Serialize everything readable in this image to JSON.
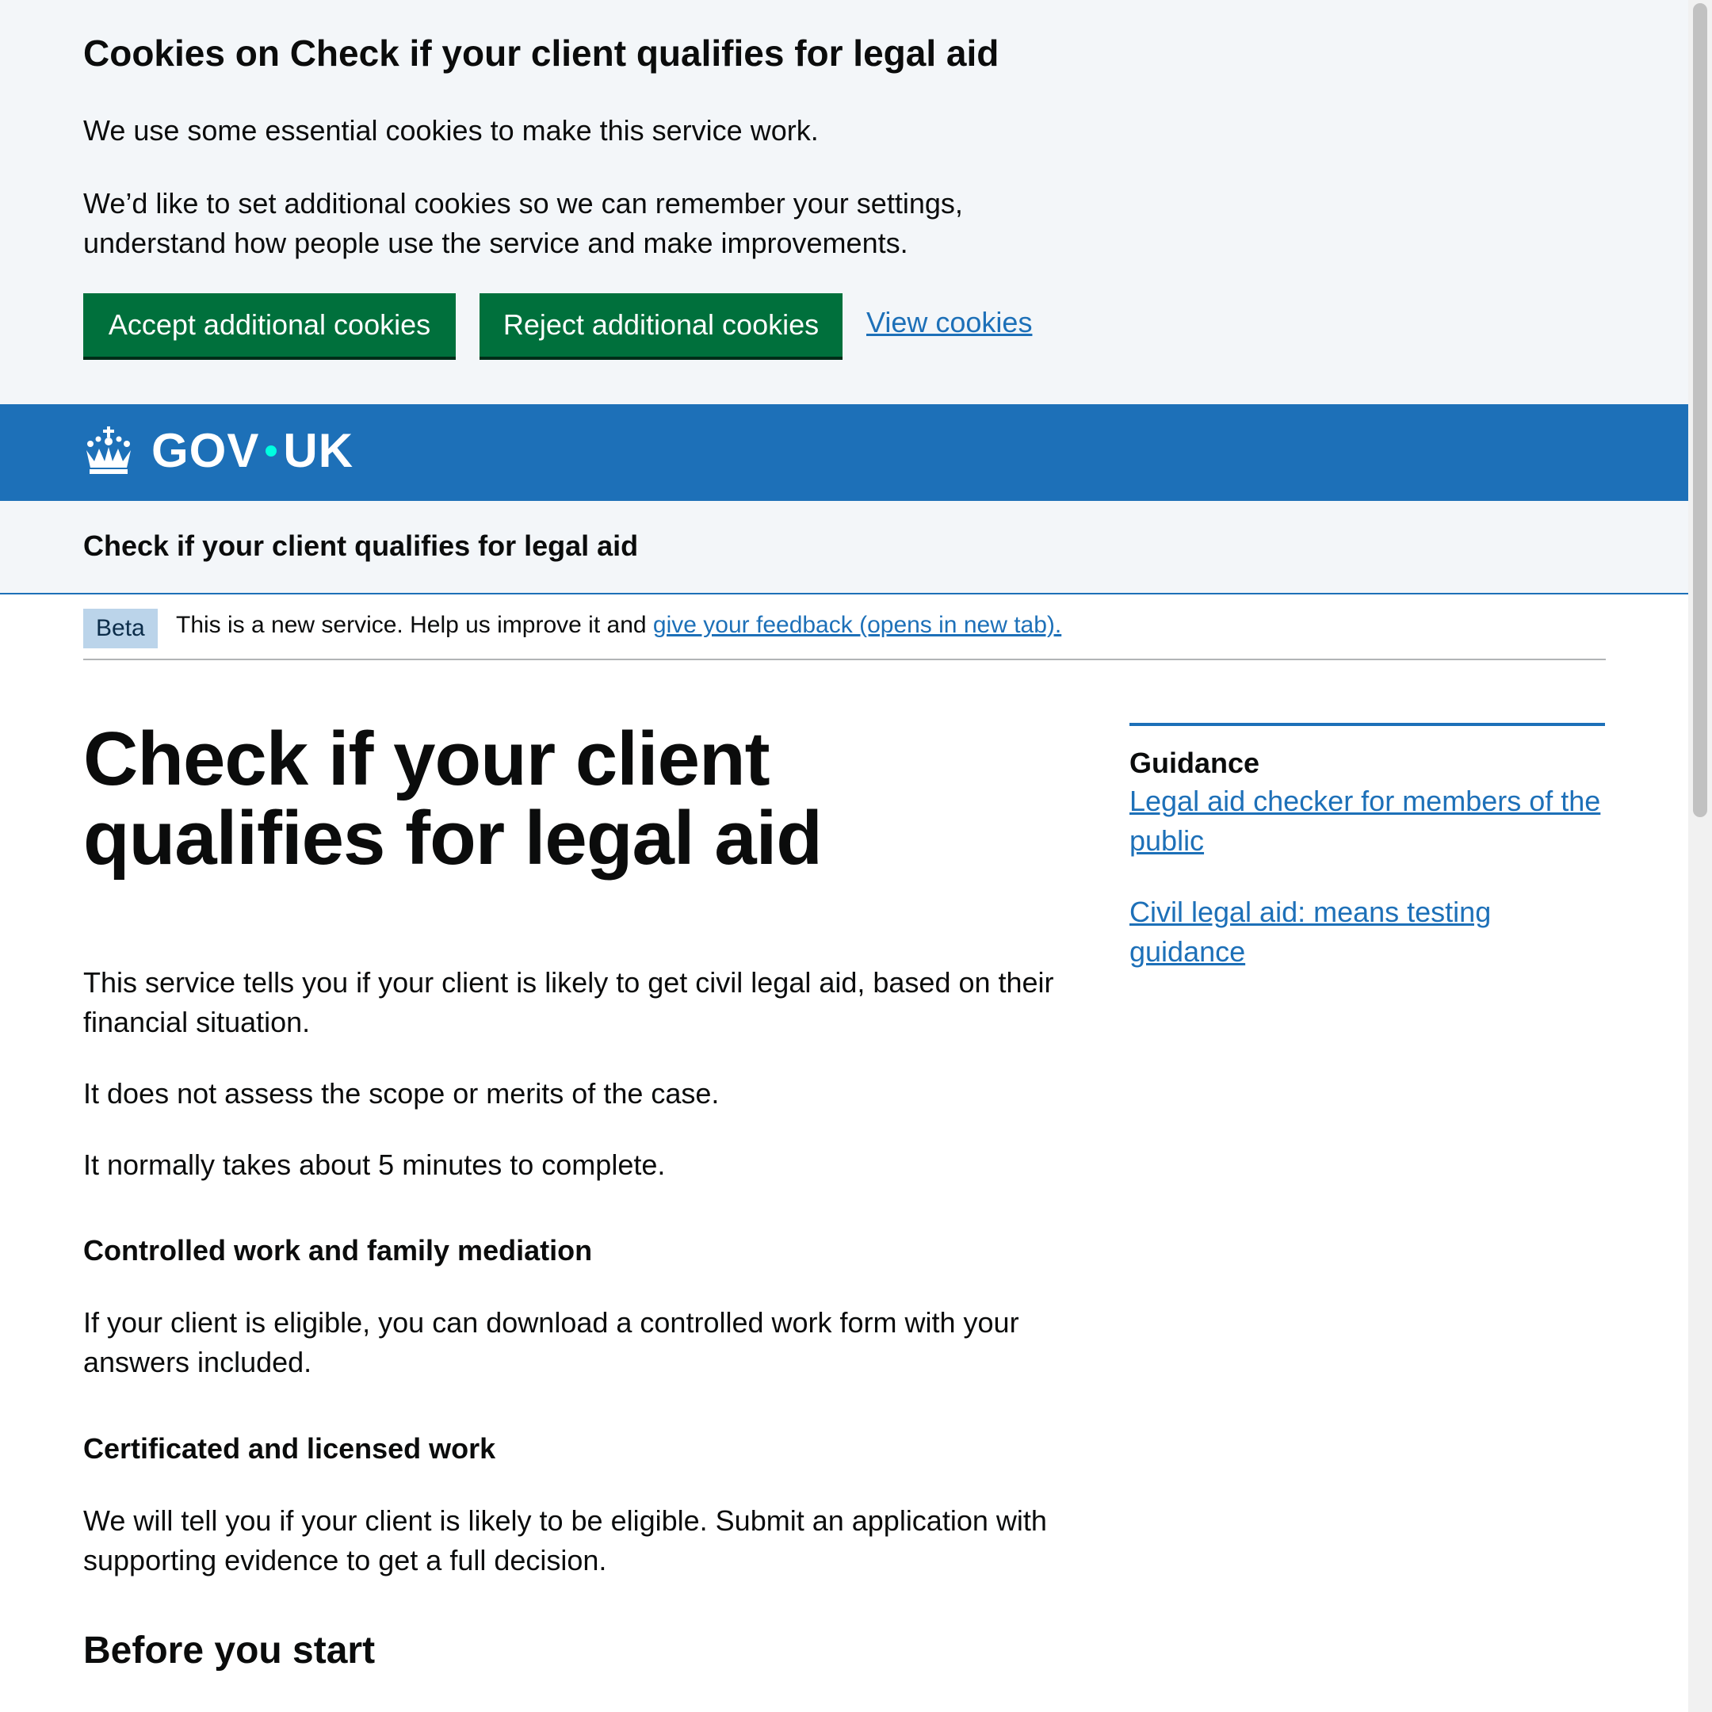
{
  "cookie_banner": {
    "title": "Cookies on Check if your client qualifies for legal aid",
    "essential_text": "We use some essential cookies to make this service work.",
    "additional_line1": "We’d like to set additional cookies so we can remember your settings,",
    "additional_line2": "understand how people use the service and make improvements.",
    "accept_label": "Accept additional cookies",
    "reject_label": "Reject additional cookies",
    "view_label": "View cookies"
  },
  "header": {
    "logo_left": "GOV",
    "logo_right": "UK",
    "service_name": "Check if your client qualifies for legal aid"
  },
  "phase_banner": {
    "tag": "Beta",
    "text": "This is a new service. Help us improve it and",
    "link": "give your feedback (opens in new tab)."
  },
  "main": {
    "title": "Check if your client qualifies for legal aid",
    "intro_line1": "This service tells you if your client is likely to get civil legal aid, based on their",
    "intro_line2": "financial situation.",
    "scope": "It does not assess the scope or merits of the case.",
    "duration": "It normally takes about 5 minutes to complete.",
    "controlled_heading": "Controlled work and family mediation",
    "controlled_line1": "If your client is eligible, you can download a controlled work form with your",
    "controlled_line2": "answers included.",
    "certificated_heading": "Certificated and licensed work",
    "certificated_line1": "We will tell you if your client is likely to be eligible. Submit an application with",
    "certificated_line2": "supporting evidence to get a full decision.",
    "before_heading": "Before you start"
  },
  "sidebar": {
    "heading": "Guidance",
    "link1_line1": "Legal aid checker for members of the",
    "link1_line2": "public",
    "link2_line1": "Civil legal aid: means testing",
    "link2_line2": "guidance"
  },
  "colors": {
    "brand_blue": "#1d70b8",
    "button_green": "#00703c",
    "banner_bg": "#f3f6f9",
    "logo_dot": "#00ffe0"
  }
}
